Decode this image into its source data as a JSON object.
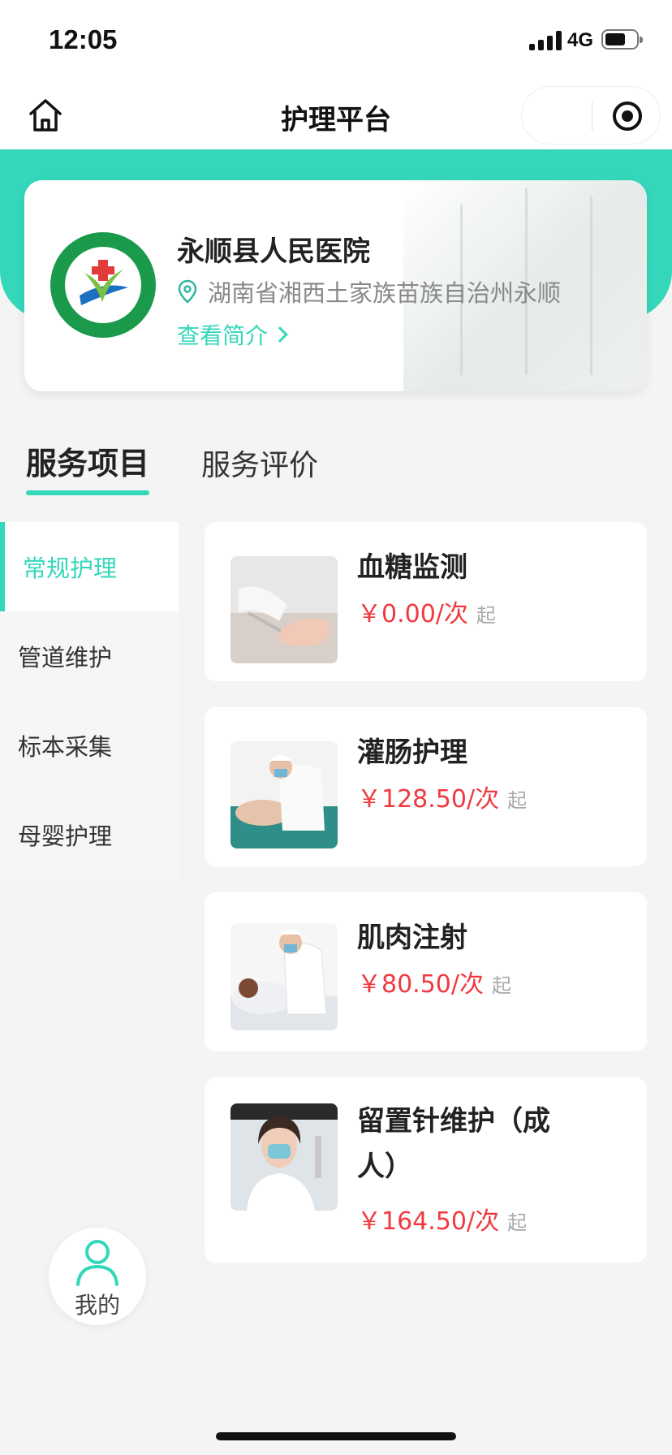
{
  "status_bar": {
    "time": "12:05",
    "network": "4G"
  },
  "nav": {
    "title": "护理平台"
  },
  "hospital": {
    "name": "永顺县人民医院",
    "address": "湖南省湘西土家族苗族自治州永顺",
    "intro_link": "查看简介"
  },
  "tabs": [
    {
      "label": "服务项目",
      "active": true
    },
    {
      "label": "服务评价",
      "active": false
    }
  ],
  "categories": [
    {
      "label": "常规护理",
      "active": true
    },
    {
      "label": "管道维护",
      "active": false
    },
    {
      "label": "标本采集",
      "active": false
    },
    {
      "label": "母婴护理",
      "active": false
    }
  ],
  "services": [
    {
      "name": "血糖监测",
      "price": "￥0.00/次",
      "suffix": "起"
    },
    {
      "name": "灌肠护理",
      "price": "￥128.50/次",
      "suffix": "起"
    },
    {
      "name": "肌肉注射",
      "price": "￥80.50/次",
      "suffix": "起"
    },
    {
      "name": "留置针维护（成人）",
      "price": "￥164.50/次",
      "suffix": "起"
    }
  ],
  "mine": {
    "label": "我的"
  },
  "colors": {
    "accent": "#35d7bb",
    "price": "#f0393f"
  }
}
